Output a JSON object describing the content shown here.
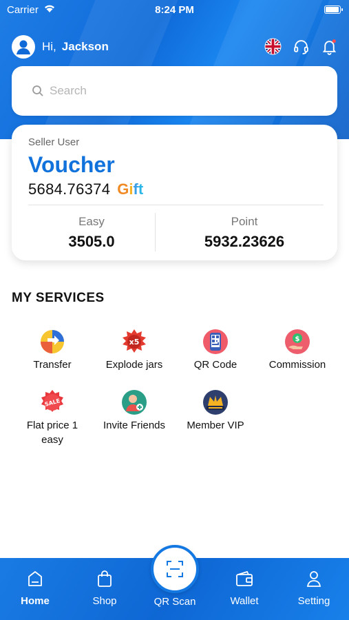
{
  "status_bar": {
    "carrier": "Carrier",
    "time": "8:24 PM",
    "battery_level": 1.0
  },
  "header": {
    "greeting": "Hi,",
    "user_name": "Jackson",
    "icons": [
      "uk-flag-icon",
      "headset-icon",
      "bell-icon"
    ]
  },
  "search": {
    "placeholder": "Search",
    "value": ""
  },
  "wallet": {
    "user_type": "Seller User",
    "title": "Voucher",
    "balance": "5684.76374",
    "gift_letters": [
      "G",
      "i",
      "f",
      "t"
    ],
    "easy_label": "Easy",
    "easy_value": "3505.0",
    "point_label": "Point",
    "point_value": "5932.23626"
  },
  "services": {
    "title": "MY SERVICES",
    "items": [
      {
        "label": "Transfer",
        "icon": "transfer-icon"
      },
      {
        "label": "Explode jars",
        "icon": "explode-x5-icon"
      },
      {
        "label": "QR Code",
        "icon": "qr-code-icon"
      },
      {
        "label": "Commission",
        "icon": "commission-icon"
      },
      {
        "label": "Flat price 1 easy",
        "icon": "sale-tag-icon"
      },
      {
        "label": "Invite Friends",
        "icon": "invite-friends-icon"
      },
      {
        "label": "Member VIP",
        "icon": "member-vip-icon"
      }
    ]
  },
  "bottom_nav": {
    "items": [
      {
        "label": "Home",
        "icon": "home-icon",
        "active": true
      },
      {
        "label": "Shop",
        "icon": "shopping-bag-icon",
        "active": false
      },
      {
        "label": "QR Scan",
        "icon": "scan-icon",
        "active": false
      },
      {
        "label": "Wallet",
        "icon": "wallet-icon",
        "active": false
      },
      {
        "label": "Setting",
        "icon": "user-icon",
        "active": false
      }
    ]
  },
  "colors": {
    "primary": "#0f6ad8",
    "voucher_text": "#1272dc",
    "gift": [
      "#f08a24",
      "#f5b223",
      "#3a9fe6",
      "#2ab7e8"
    ]
  }
}
